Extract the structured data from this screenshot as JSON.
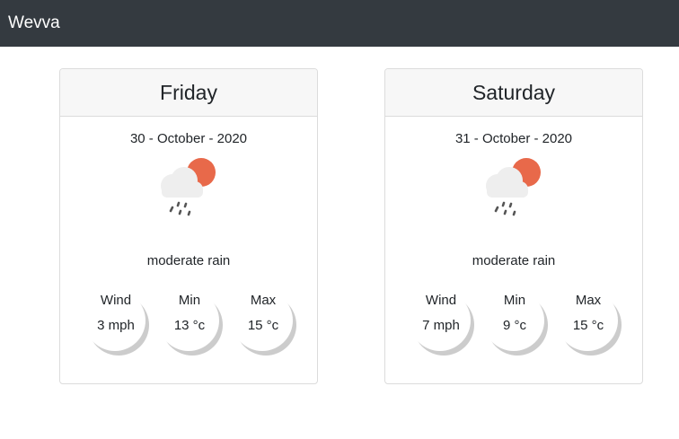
{
  "navbar": {
    "brand": "Wevva"
  },
  "days": [
    {
      "day": "Friday",
      "date": "30 - October - 2020",
      "condition": "moderate rain",
      "icon": "rain-cloud-sun-icon",
      "wind_label": "Wind",
      "wind": "3 mph",
      "min_label": "Min",
      "min": "13 °c",
      "max_label": "Max",
      "max": "15 °c"
    },
    {
      "day": "Saturday",
      "date": "31 - October - 2020",
      "condition": "moderate rain",
      "icon": "rain-cloud-sun-icon",
      "wind_label": "Wind",
      "wind": "7 mph",
      "min_label": "Min",
      "min": "9 °c",
      "max_label": "Max",
      "max": "15 °c"
    }
  ],
  "colors": {
    "navbar": "#343a40",
    "sun": "#e8694a",
    "cloud": "#eeeeee",
    "rain": "#555555"
  }
}
